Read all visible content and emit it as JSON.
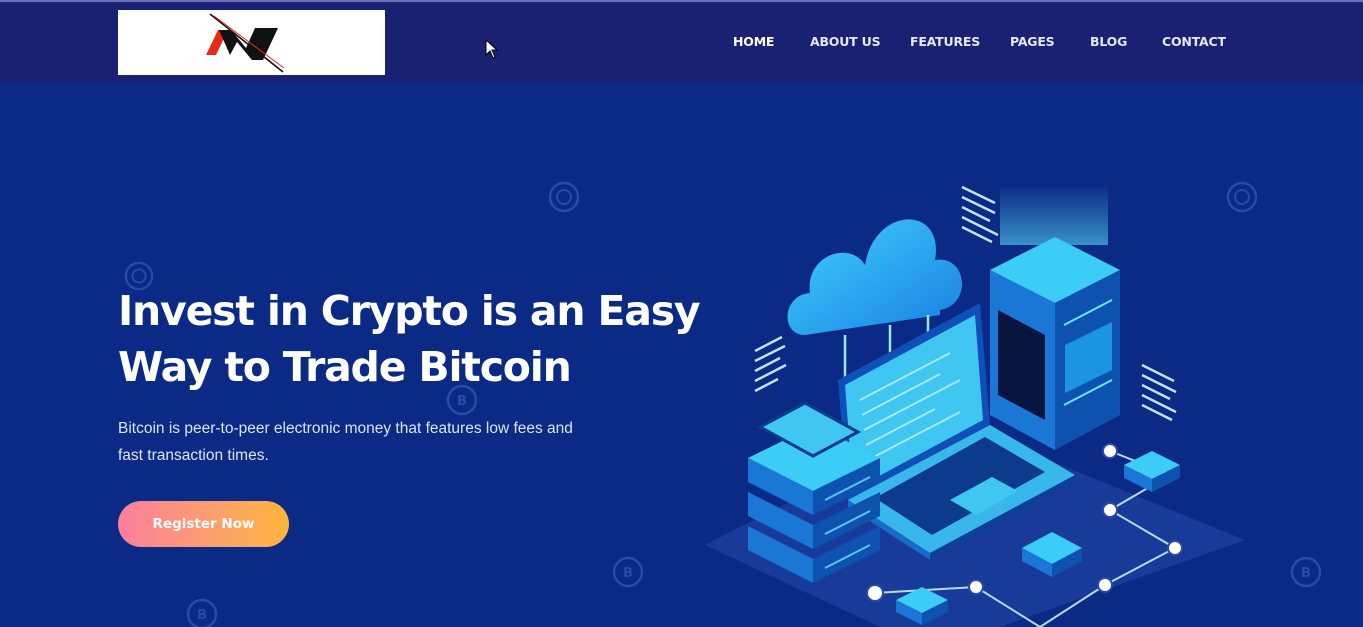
{
  "header": {
    "logo_alt": "N logo",
    "nav": [
      {
        "label": "HOME",
        "active": true
      },
      {
        "label": "ABOUT US",
        "active": false
      },
      {
        "label": "FEATURES",
        "active": false
      },
      {
        "label": "PAGES",
        "active": false
      },
      {
        "label": "BLOG",
        "active": false
      },
      {
        "label": "CONTACT",
        "active": false
      }
    ]
  },
  "hero": {
    "title_line1": "Invest in Crypto is an Easy",
    "title_line2": "Way to Trade Bitcoin",
    "subtitle": "Bitcoin is peer-to-peer electronic money that features low fees and fast transaction times.",
    "cta_label": "Register Now"
  },
  "colors": {
    "header_bg": "#1a2172",
    "hero_bg": "#0a2a85",
    "cta_gradient_start": "#fb7f9d",
    "cta_gradient_end": "#ffb43a"
  },
  "icons": [
    "n-logo",
    "mouse-cursor-icon",
    "bitcoin-coin-icon",
    "cloud-server-laptop-illustration"
  ]
}
